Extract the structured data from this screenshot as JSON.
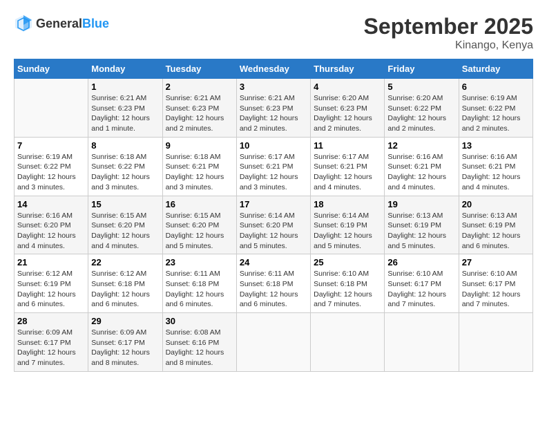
{
  "header": {
    "logo_general": "General",
    "logo_blue": "Blue",
    "title": "September 2025",
    "location": "Kinango, Kenya"
  },
  "weekdays": [
    "Sunday",
    "Monday",
    "Tuesday",
    "Wednesday",
    "Thursday",
    "Friday",
    "Saturday"
  ],
  "weeks": [
    [
      {
        "day": "",
        "info": ""
      },
      {
        "day": "1",
        "info": "Sunrise: 6:21 AM\nSunset: 6:23 PM\nDaylight: 12 hours\nand 1 minute."
      },
      {
        "day": "2",
        "info": "Sunrise: 6:21 AM\nSunset: 6:23 PM\nDaylight: 12 hours\nand 2 minutes."
      },
      {
        "day": "3",
        "info": "Sunrise: 6:21 AM\nSunset: 6:23 PM\nDaylight: 12 hours\nand 2 minutes."
      },
      {
        "day": "4",
        "info": "Sunrise: 6:20 AM\nSunset: 6:23 PM\nDaylight: 12 hours\nand 2 minutes."
      },
      {
        "day": "5",
        "info": "Sunrise: 6:20 AM\nSunset: 6:22 PM\nDaylight: 12 hours\nand 2 minutes."
      },
      {
        "day": "6",
        "info": "Sunrise: 6:19 AM\nSunset: 6:22 PM\nDaylight: 12 hours\nand 2 minutes."
      }
    ],
    [
      {
        "day": "7",
        "info": "Sunrise: 6:19 AM\nSunset: 6:22 PM\nDaylight: 12 hours\nand 3 minutes."
      },
      {
        "day": "8",
        "info": "Sunrise: 6:18 AM\nSunset: 6:22 PM\nDaylight: 12 hours\nand 3 minutes."
      },
      {
        "day": "9",
        "info": "Sunrise: 6:18 AM\nSunset: 6:21 PM\nDaylight: 12 hours\nand 3 minutes."
      },
      {
        "day": "10",
        "info": "Sunrise: 6:17 AM\nSunset: 6:21 PM\nDaylight: 12 hours\nand 3 minutes."
      },
      {
        "day": "11",
        "info": "Sunrise: 6:17 AM\nSunset: 6:21 PM\nDaylight: 12 hours\nand 4 minutes."
      },
      {
        "day": "12",
        "info": "Sunrise: 6:16 AM\nSunset: 6:21 PM\nDaylight: 12 hours\nand 4 minutes."
      },
      {
        "day": "13",
        "info": "Sunrise: 6:16 AM\nSunset: 6:21 PM\nDaylight: 12 hours\nand 4 minutes."
      }
    ],
    [
      {
        "day": "14",
        "info": "Sunrise: 6:16 AM\nSunset: 6:20 PM\nDaylight: 12 hours\nand 4 minutes."
      },
      {
        "day": "15",
        "info": "Sunrise: 6:15 AM\nSunset: 6:20 PM\nDaylight: 12 hours\nand 4 minutes."
      },
      {
        "day": "16",
        "info": "Sunrise: 6:15 AM\nSunset: 6:20 PM\nDaylight: 12 hours\nand 5 minutes."
      },
      {
        "day": "17",
        "info": "Sunrise: 6:14 AM\nSunset: 6:20 PM\nDaylight: 12 hours\nand 5 minutes."
      },
      {
        "day": "18",
        "info": "Sunrise: 6:14 AM\nSunset: 6:19 PM\nDaylight: 12 hours\nand 5 minutes."
      },
      {
        "day": "19",
        "info": "Sunrise: 6:13 AM\nSunset: 6:19 PM\nDaylight: 12 hours\nand 5 minutes."
      },
      {
        "day": "20",
        "info": "Sunrise: 6:13 AM\nSunset: 6:19 PM\nDaylight: 12 hours\nand 6 minutes."
      }
    ],
    [
      {
        "day": "21",
        "info": "Sunrise: 6:12 AM\nSunset: 6:19 PM\nDaylight: 12 hours\nand 6 minutes."
      },
      {
        "day": "22",
        "info": "Sunrise: 6:12 AM\nSunset: 6:18 PM\nDaylight: 12 hours\nand 6 minutes."
      },
      {
        "day": "23",
        "info": "Sunrise: 6:11 AM\nSunset: 6:18 PM\nDaylight: 12 hours\nand 6 minutes."
      },
      {
        "day": "24",
        "info": "Sunrise: 6:11 AM\nSunset: 6:18 PM\nDaylight: 12 hours\nand 6 minutes."
      },
      {
        "day": "25",
        "info": "Sunrise: 6:10 AM\nSunset: 6:18 PM\nDaylight: 12 hours\nand 7 minutes."
      },
      {
        "day": "26",
        "info": "Sunrise: 6:10 AM\nSunset: 6:17 PM\nDaylight: 12 hours\nand 7 minutes."
      },
      {
        "day": "27",
        "info": "Sunrise: 6:10 AM\nSunset: 6:17 PM\nDaylight: 12 hours\nand 7 minutes."
      }
    ],
    [
      {
        "day": "28",
        "info": "Sunrise: 6:09 AM\nSunset: 6:17 PM\nDaylight: 12 hours\nand 7 minutes."
      },
      {
        "day": "29",
        "info": "Sunrise: 6:09 AM\nSunset: 6:17 PM\nDaylight: 12 hours\nand 8 minutes."
      },
      {
        "day": "30",
        "info": "Sunrise: 6:08 AM\nSunset: 6:16 PM\nDaylight: 12 hours\nand 8 minutes."
      },
      {
        "day": "",
        "info": ""
      },
      {
        "day": "",
        "info": ""
      },
      {
        "day": "",
        "info": ""
      },
      {
        "day": "",
        "info": ""
      }
    ]
  ]
}
